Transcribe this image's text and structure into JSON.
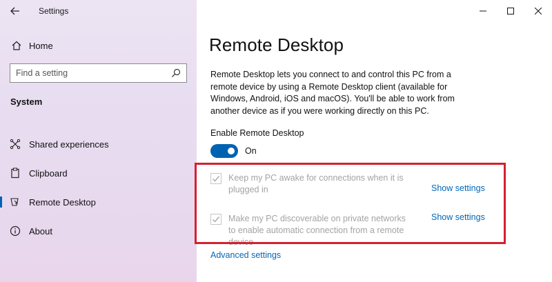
{
  "window": {
    "title": "Settings"
  },
  "sidebar": {
    "home_label": "Home",
    "search_placeholder": "Find a setting",
    "section_title": "System",
    "items": [
      {
        "label": "Shared experiences",
        "icon": "shared-experiences-icon",
        "selected": false
      },
      {
        "label": "Clipboard",
        "icon": "clipboard-icon",
        "selected": false
      },
      {
        "label": "Remote Desktop",
        "icon": "remote-desktop-icon",
        "selected": true
      },
      {
        "label": "About",
        "icon": "info-icon",
        "selected": false
      }
    ]
  },
  "main": {
    "title": "Remote Desktop",
    "description": "Remote Desktop lets you connect to and control this PC from a remote device by using a Remote Desktop client (available for Windows, Android, iOS and macOS). You'll be able to work from another device as if you were working directly on this PC.",
    "enable_label": "Enable Remote Desktop",
    "toggle_state": "On",
    "toggle_on": true,
    "options": [
      {
        "text": "Keep my PC awake for connections when it is plugged in",
        "checked": true,
        "disabled": true,
        "link": "Show settings"
      },
      {
        "text": "Make my PC discoverable on private networks to enable automatic connection from a remote device",
        "checked": true,
        "disabled": true,
        "link": "Show settings"
      }
    ],
    "advanced_link": "Advanced settings"
  },
  "colors": {
    "accent": "#0063b1",
    "link": "#0067b8",
    "highlight": "#d51f2e"
  }
}
